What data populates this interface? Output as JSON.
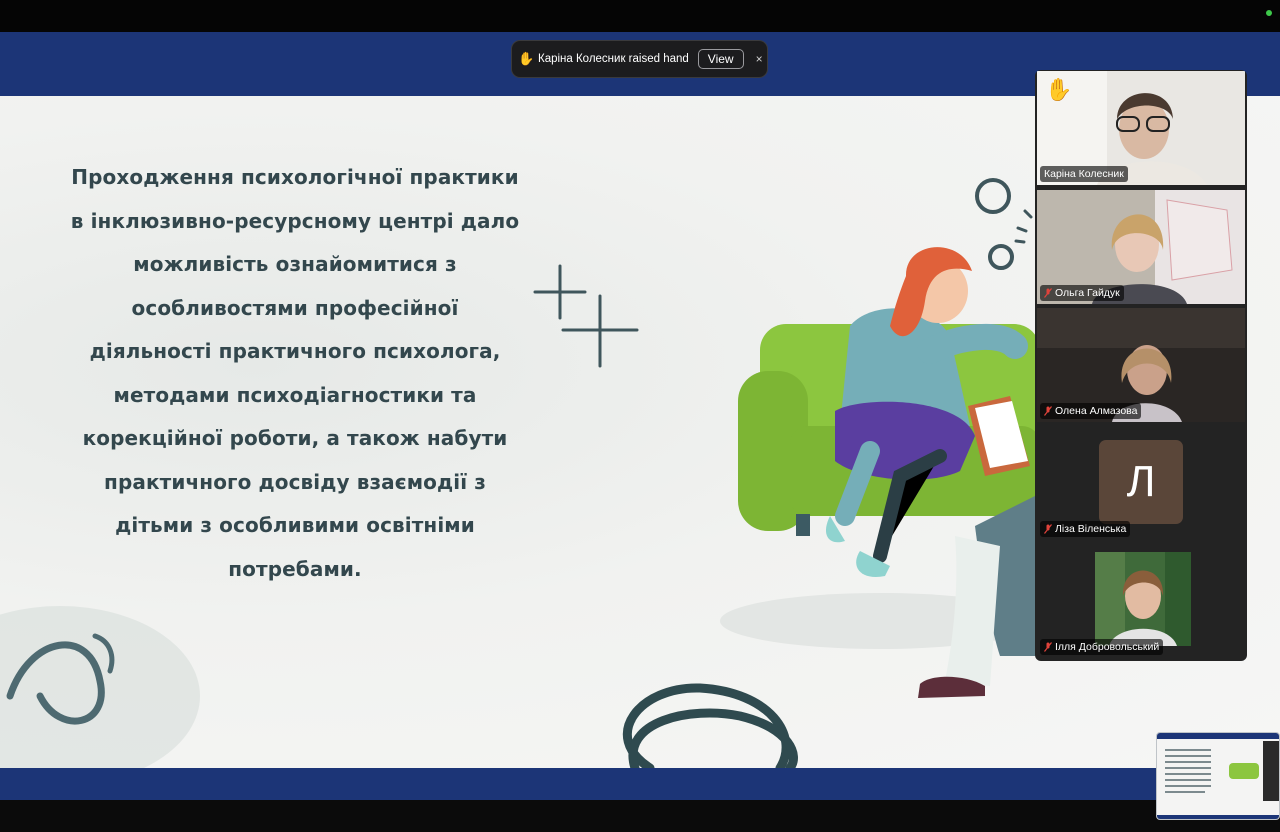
{
  "slide": {
    "text": "Проходження психологічної практики в інклюзивно-ресурсному центрі дало можливість ознайомитися з особливостями професійної діяльності практичного психолога, методами психодіагностики та корекційної роботи, а також набути практичного досвіду взаємодії з дітьми з особливими освітніми потребами.",
    "colors": {
      "band": "#1c3577",
      "text": "#33474d",
      "sofa": "#8cc63f"
    }
  },
  "notification": {
    "icon": "raised-hand-icon",
    "text": "Каріна Колесник raised hand",
    "view_label": "View",
    "close_label": "×"
  },
  "participants": [
    {
      "name": "Каріна Колесник",
      "hand_raised": true,
      "muted": false,
      "icon": "raised-hand-icon"
    },
    {
      "name": "Ольга Гайдук",
      "muted": true,
      "icon": "mic-muted-icon"
    },
    {
      "name": "Олена Алмазова",
      "muted": true,
      "icon": "mic-muted-icon"
    },
    {
      "name": "Ліза Віленська",
      "muted": true,
      "avatar_initial": "Л",
      "icon": "mic-muted-icon"
    },
    {
      "name": "Ілля Добровольський",
      "muted": true,
      "icon": "mic-muted-icon"
    }
  ],
  "colors": {
    "active_speaker": "#39c659",
    "muted_icon": "#e0433b"
  }
}
